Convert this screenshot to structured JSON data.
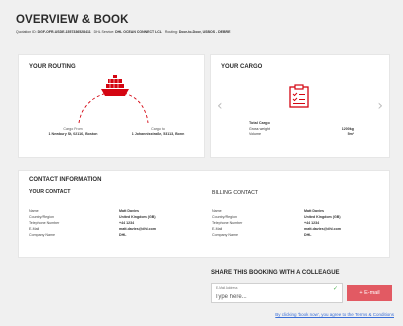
{
  "header": {
    "title": "OVERVIEW & BOOK",
    "quotation_label": "Quotation ID:",
    "quotation_id": "DGF-OFR-USDE-1557336528411",
    "dhl_service_label": "DHL Service:",
    "dhl_service": "DHL OCEAN CONNECT LCL",
    "routing_label": "Routing:",
    "routing": "Door-to-Door, USBOS - DEBRE"
  },
  "routing_card": {
    "title": "YOUR ROUTING",
    "from_label": "Cargo From",
    "from_address": "1 Newbury St, 02116, Boston",
    "to_label": "Cargo to",
    "to_address": "1 Johannisstraße, 53113, Bonn",
    "icon": "ship-icon",
    "accent": "#d40511"
  },
  "cargo_card": {
    "title": "YOUR CARGO",
    "icon": "clipboard-checklist-icon",
    "total_label": "Total Cargo",
    "rows": [
      {
        "label": "Gross weight",
        "value": "1200kg"
      },
      {
        "label": "Volume",
        "value": "5m³"
      }
    ],
    "prev_icon": "chevron-left-icon",
    "next_icon": "chevron-right-icon"
  },
  "contact_card": {
    "heading": "CONTACT INFORMATION",
    "your_contact": {
      "title": "YOUR CONTACT",
      "rows": [
        {
          "label": "Name",
          "value": "Matt Davies"
        },
        {
          "label": "Country/Region",
          "value": "United Kingdom (GB)"
        },
        {
          "label": "Telephone Number",
          "value": "+44 1234"
        },
        {
          "label": "E-Mail",
          "value": "matt.davies@dhl.com"
        },
        {
          "label": "Company Name",
          "value": "DHL"
        }
      ]
    },
    "billing_contact": {
      "title": "BILLING CONTACT",
      "rows": [
        {
          "label": "Name",
          "value": "Matt Davies"
        },
        {
          "label": "Country/Region",
          "value": "United Kingdom (GB)"
        },
        {
          "label": "Telephone Number",
          "value": "+44 1234"
        },
        {
          "label": "E-Mail",
          "value": "matt.davies@dhl.com"
        },
        {
          "label": "Company Name",
          "value": "DHL"
        }
      ]
    }
  },
  "share": {
    "title": "SHARE THIS BOOKING WITH A COLLEAGUE",
    "email_label": "E-Mail Address",
    "email_placeholder": "Type here...",
    "email_value": "",
    "add_button": "+ E-mail",
    "button_color": "#e25a63",
    "valid_icon": "check-icon"
  },
  "terms_link": "By clicking 'book now', you agree to the Terms & Conditions"
}
